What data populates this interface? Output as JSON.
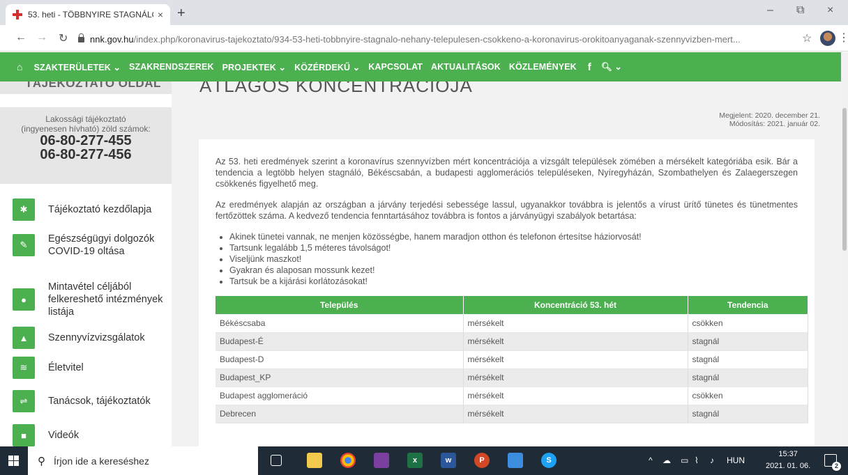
{
  "browser": {
    "tab_title": "53. heti - TÖBBNYIRE STAGNÁLÓ",
    "tab_close": "×",
    "new_tab": "+",
    "win_minimize": "–",
    "win_restore": "⧉",
    "win_close": "×",
    "url_host": "nnk.gov.hu",
    "url_path": "/index.php/koronavirus-tajekoztato/934-53-heti-tobbnyire-stagnalo-nehany-telepulesen-csokkeno-a-koronavirus-orokitoanyaganak-szennyvizben-mert..."
  },
  "sitenav": {
    "items": [
      "SZAKTERÜLETEK ⌄",
      "SZAKRENDSZEREK",
      "PROJEKTEK ⌄",
      "KÖZÉRDEKŰ ⌄",
      "KAPCSOLAT",
      "AKTUALITÁSOK",
      "KÖZLEMÉNYEK"
    ],
    "fb": "f",
    "search": "🔍︎ ⌄"
  },
  "sidebar": {
    "top_heading": "TÁJÉKOZTATÓ OLDAL",
    "info_lead1": "Lakossági tájékoztató",
    "info_lead2": "(ingyenesen hívható) zöld számok:",
    "phone1": "06-80-277-455",
    "phone2": "06-80-277-456",
    "items": [
      {
        "label": "Tájékoztató kezdőlapja",
        "icon": "✱"
      },
      {
        "label": "Egészségügyi dolgozók COVID-19 oltása",
        "icon": "✎"
      },
      {
        "label": "Mintavétel céljából felkereshető intézmények listája",
        "icon": "●"
      },
      {
        "label": "Szennyvízvizsgálatok",
        "icon": "▲"
      },
      {
        "label": "Életvitel",
        "icon": "≋"
      },
      {
        "label": "Tanácsok, tájékoztatók",
        "icon": "⇌"
      },
      {
        "label": "Videók",
        "icon": "■"
      }
    ]
  },
  "article": {
    "heading": "ÁTLAGOS KONCENTRÁCIÓJA",
    "published": "Megjelent: 2020. december 21.",
    "modified": "Módosítás: 2021. január 02.",
    "para1": "Az 53. heti eredmények szerint a koronavírus szennyvízben mért koncentrációja a vizsgált települések zömében a mérsékelt kategóriába esik. Bár a tendencia a legtöbb helyen stagnáló, Békéscsabán, a budapesti agglomerációs településeken, Nyíregyházán, Szombathelyen és Zalaegerszegen csökkenés figyelhető meg.",
    "para2": "Az eredmények alapján az országban a járvány terjedési sebessége lassul, ugyanakkor továbbra is jelentős a vírust ürítő tünetes és tünetmentes fertőzöttek száma. A kedvező tendencia fenntartásához továbbra is fontos a járványügyi szabályok betartása:",
    "bullets": [
      "Akinek tünetei vannak, ne menjen közösségbe, hanem maradjon otthon és telefonon értesítse háziorvosát!",
      "Tartsunk legalább 1,5 méteres távolságot!",
      "Viseljünk maszkot!",
      "Gyakran és alaposan mossunk kezet!",
      "Tartsuk be a kijárási korlátozásokat!"
    ],
    "table": {
      "headers": [
        "Település",
        "Koncentráció 53. hét",
        "Tendencia"
      ],
      "rows": [
        [
          "Békéscsaba",
          "mérsékelt",
          "csökken"
        ],
        [
          "Budapest-É",
          "mérsékelt",
          "stagnál"
        ],
        [
          "Budapest-D",
          "mérsékelt",
          "stagnál"
        ],
        [
          "Budapest_KP",
          "mérsékelt",
          "stagnál"
        ],
        [
          "Budapest agglomeráció",
          "mérsékelt",
          "csökken"
        ],
        [
          "Debrecen",
          "mérsékelt",
          "stagnál"
        ]
      ]
    }
  },
  "taskbar": {
    "search_placeholder": "Írjon ide a kereséshez",
    "lang": "HUN",
    "time": "15:37",
    "date": "2021. 01. 06.",
    "notif_count": "2"
  }
}
